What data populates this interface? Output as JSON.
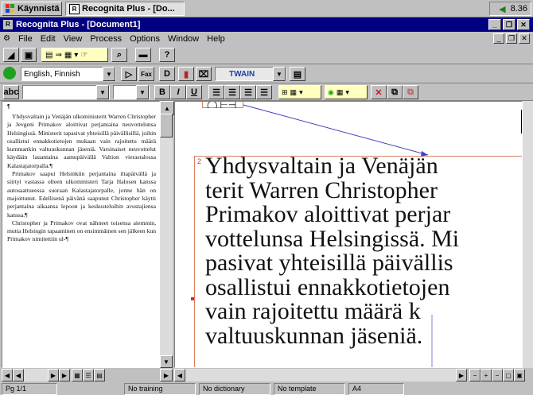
{
  "taskbar": {
    "start_label": "Käynnistä",
    "window_label": "Recognita Plus - [Do...",
    "clock": "8.36"
  },
  "title": "Recognita Plus - [Document1]",
  "menu": [
    "File",
    "Edit",
    "View",
    "Process",
    "Options",
    "Window",
    "Help"
  ],
  "toolbar2": {
    "language": "English, Finnish",
    "fax_label": "Fax",
    "scanner": "TWAIN"
  },
  "toolbar3": {
    "bold": "B",
    "italic": "I",
    "underline": "U"
  },
  "left_pane": {
    "paragraphs": [
      "Yhdysvaltain ja Venäjän ulkoministerit Warren Christopher ja Jevgeni Primakov aloittivat perjantaina neuvottelunsa Helsingissä. Ministerit tapasivat yhteisillä päivällisillä, joihin osallistui ennakkotietojen mukaan vain rajoitettu määrä kummankin valtuuskunnan jäseniä. Varsinaiset neuvottelut käydään lauantaina aamupäivällä Valtion vierastalossa Kalastajatorpalla.¶",
      "Primakov saapui Helsinkiin perjantaina iltapäivällä ja siirtyi vastassa olleen ulkoministeri Tarja Halosen kanssa autosaattueessa suoraan Kalastajatorpalle, jonne hän on majoittunut. Edellisenä päivänä saapunut Christopher käytti perjantaina aikaansa lepoon ja keskusteluihin avustajiensa kanssa.¶",
      "Christopher ja Primakov ovat nähneet toisensa aiemmin, mutta Helsingin tapaaminen on ensimmäinen sen jälkeen kun Primakov nimitettiin ul-¶"
    ]
  },
  "right_pane": {
    "zone_number": "2",
    "lines": [
      "Yhdysvaltain ja Venäjän",
      "terit Warren Christopher",
      "Primakov aloittivat perjar",
      "vottelunsa Helsingissä. Mi",
      "pasivat yhteisillä päivällis",
      "osallistui ennakkotietojen",
      "vain rajoitettu määrä k",
      "valtuuskunnan jäseniä."
    ]
  },
  "status": {
    "page": "Pg 1/1",
    "training": "No training",
    "dictionary": "No dictionary",
    "template": "No template",
    "paper": "A4"
  },
  "colors": {
    "title_bg": "#000080",
    "zone_border": "#d88060",
    "link_line": "#4040c0"
  }
}
